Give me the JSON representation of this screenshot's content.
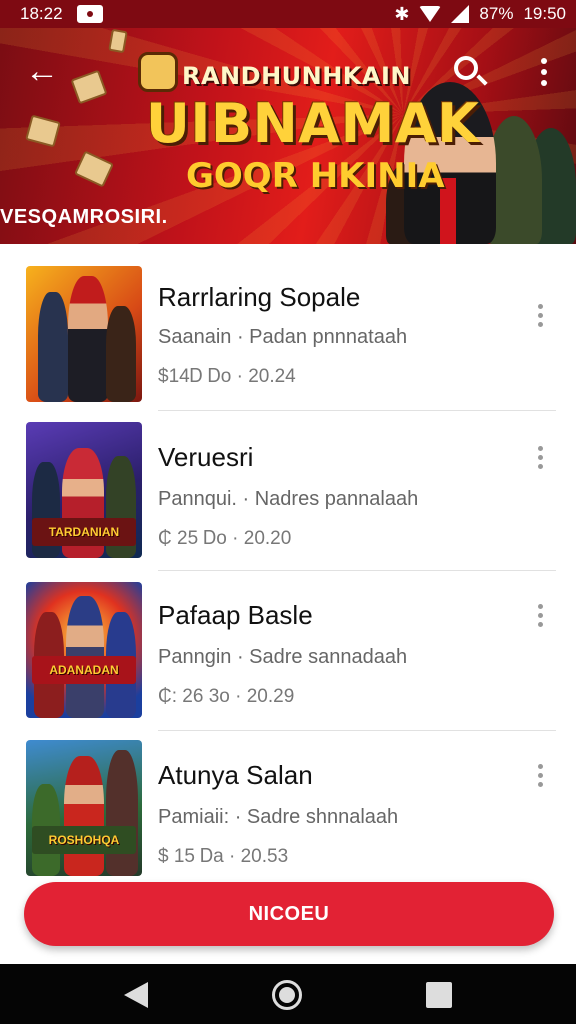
{
  "status_bar": {
    "time_left": "18:22",
    "battery": "87%",
    "time_right": "19:50",
    "icons": [
      "notification-icon",
      "bluetooth-icon",
      "wifi-icon",
      "signal-icon"
    ]
  },
  "header": {
    "back_icon": "arrow-left-icon",
    "search_icon": "search-icon",
    "menu_icon": "more-vert-icon",
    "super_title": "RANDHUNHKAIN",
    "title": "UIBNAMAK",
    "subtitle": "GOQR HKINIA",
    "caption": "VESQAMROSIRI."
  },
  "items": [
    {
      "title": "Rarrlaring Sopale",
      "subtitle": "Saanain  ·  Padan pnnnataah",
      "meta": "$14Ꭰ Ꭰo  ·  20.24",
      "thumb_label": "",
      "thumb_colors": [
        "#f2a31b",
        "#c21d1d",
        "#23254f"
      ]
    },
    {
      "title": "Veruesri",
      "subtitle": "Pannqui.  ·  Nadres pannalaah",
      "meta": "₵ 25 Ꭰo  ·  20.20",
      "thumb_label": "TARDANIAN",
      "thumb_colors": [
        "#3b2a8f",
        "#d03140",
        "#1c3a6a"
      ]
    },
    {
      "title": "Pafaap Basle",
      "subtitle": "Panngin  ·  Sadre sannadaah",
      "meta": "₵: 26 3o  ·  20.29",
      "thumb_label": "ADANADAN",
      "thumb_colors": [
        "#1e5bc2",
        "#e7342b",
        "#2a1a4a"
      ]
    },
    {
      "title": "Atunya Salan",
      "subtitle": "Pamiaii:  ·  Sadre shnnalaah",
      "meta": "$ 15 Ꭰa  ·  20.53",
      "thumb_label": "ROSHOHQA",
      "thumb_colors": [
        "#3d8f3c",
        "#d6261c",
        "#274b78"
      ]
    }
  ],
  "action_button": {
    "label": "NICOEU"
  },
  "nav": {
    "back_icon": "nav-back-icon",
    "home_icon": "nav-home-icon",
    "recent_icon": "nav-recent-icon"
  },
  "colors": {
    "accent": "#e22234",
    "banner": "#c0121a",
    "status_bar": "#7e0a12"
  }
}
